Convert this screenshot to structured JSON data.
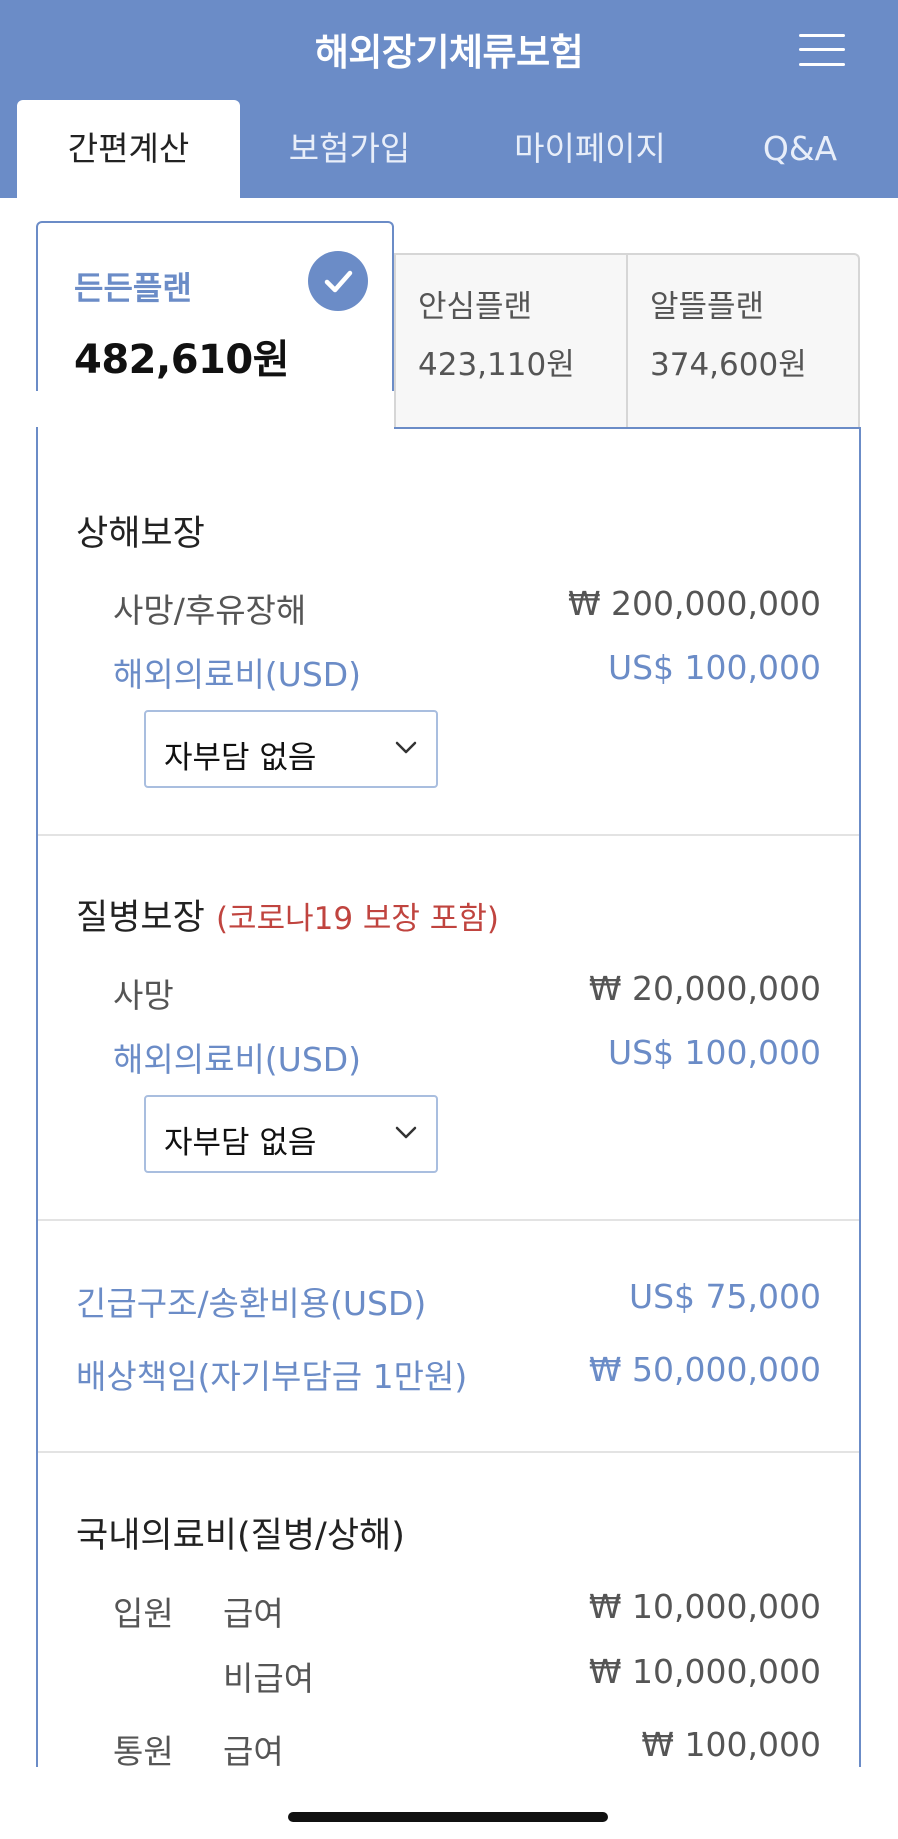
{
  "header": {
    "title": "해외장기체류보험",
    "menu_icon": "hamburger-menu-icon",
    "background": "#6b8cc7"
  },
  "nav": {
    "tabs": [
      {
        "label": "간편계산",
        "active": true
      },
      {
        "label": "보험가입",
        "active": false
      },
      {
        "label": "마이페이지",
        "active": false
      },
      {
        "label": "Q&A",
        "active": false
      }
    ]
  },
  "plans": [
    {
      "name": "든든플랜",
      "price": "482,610원",
      "selected": true
    },
    {
      "name": "안심플랜",
      "price": "423,110원",
      "selected": false
    },
    {
      "name": "알뜰플랜",
      "price": "374,600원",
      "selected": false
    }
  ],
  "injury": {
    "title": "상해보장",
    "death_label": "사망/후유장해",
    "death_value": "₩ 200,000,000",
    "medical_label": "해외의료비(USD)",
    "medical_value": "US$ 100,000",
    "deductible": "자부담 없음"
  },
  "disease": {
    "title": "질병보장",
    "note": "(코로나19 보장 포함)",
    "death_label": "사망",
    "death_value": "₩ 20,000,000",
    "medical_label": "해외의료비(USD)",
    "medical_value": "US$ 100,000",
    "deductible": "자부담 없음"
  },
  "extra": {
    "rescue_label": "긴급구조/송환비용(USD)",
    "rescue_value": "US$ 75,000",
    "liability_label": "배상책임(자기부담금 1만원)",
    "liability_value": "₩ 50,000,000"
  },
  "domestic": {
    "title": "국내의료비(질병/상해)",
    "inpatient_label": "입원",
    "inpatient_covered_label": "급여",
    "inpatient_covered_value": "₩ 10,000,000",
    "inpatient_noncovered_label": "비급여",
    "inpatient_noncovered_value": "₩ 10,000,000",
    "outpatient_label": "통원",
    "outpatient_covered_label": "급여",
    "outpatient_covered_value": "₩ 100,000"
  },
  "colors": {
    "accent": "#6b8cc7",
    "note_red": "#c0443f"
  }
}
